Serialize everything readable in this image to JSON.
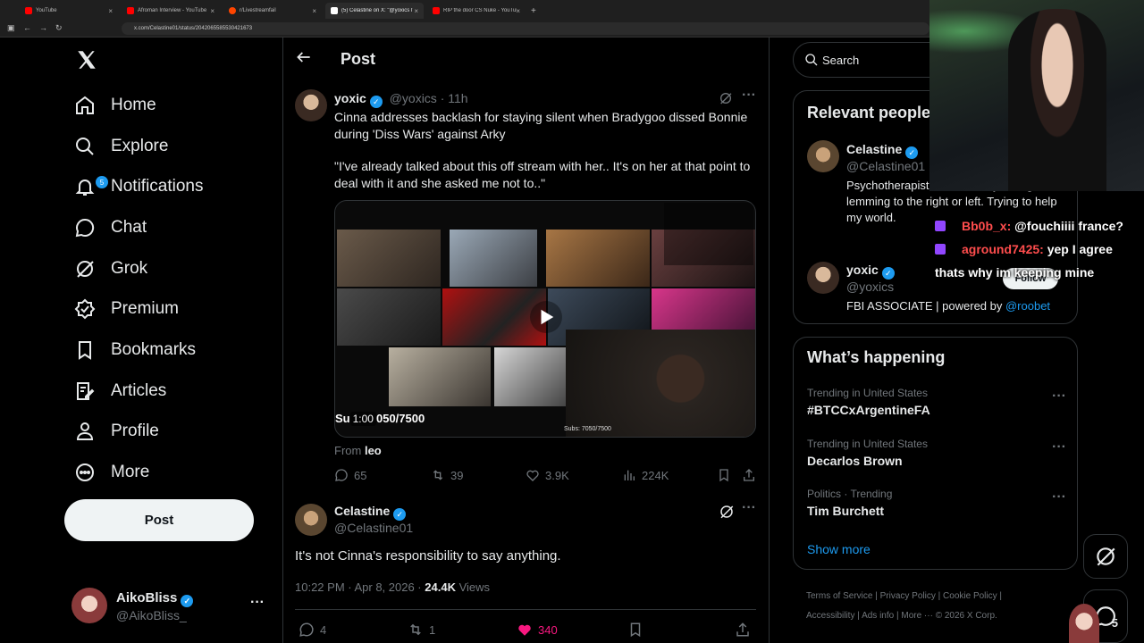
{
  "browser": {
    "tabs": [
      {
        "label": "YouTube",
        "color": "#ff0000"
      },
      {
        "label": "Afroman Interview - YouTube",
        "color": "#ff0000"
      },
      {
        "label": "r/Livestreamfail",
        "color": "#ff4500"
      },
      {
        "label": "(5) Celastine on X: \"@yoxics It's",
        "color": "#ffffff"
      },
      {
        "label": "RIP the door CS Nuke - YouTub",
        "color": "#ff0000"
      }
    ],
    "new_tab": "+",
    "url": "x.com/Celastine01/status/2042065585530421673"
  },
  "nav": {
    "items": [
      {
        "label": "Home",
        "icon": "home-icon"
      },
      {
        "label": "Explore",
        "icon": "search-icon"
      },
      {
        "label": "Notifications",
        "icon": "bell-icon",
        "badge": "5"
      },
      {
        "label": "Chat",
        "icon": "chat-icon"
      },
      {
        "label": "Grok",
        "icon": "grok-icon"
      },
      {
        "label": "Premium",
        "icon": "premium-icon"
      },
      {
        "label": "Bookmarks",
        "icon": "bookmark-icon"
      },
      {
        "label": "Articles",
        "icon": "articles-icon"
      },
      {
        "label": "Profile",
        "icon": "profile-icon"
      },
      {
        "label": "More",
        "icon": "more-circle-icon"
      }
    ],
    "post_button": "Post",
    "account": {
      "name": "AikoBliss",
      "handle": "@AikoBliss_"
    }
  },
  "header": {
    "title": "Post"
  },
  "quoted_post": {
    "name": "yoxic",
    "handle": "@yoxics",
    "time": "· 11h",
    "text1": "Cinna addresses backlash for staying silent when Bradygoo dissed Bonnie during 'Diss Wars' against Arky",
    "text2": "\"I've already talked about this off stream with her.. It's on her at that point to deal with it and she asked me not to..\"",
    "video_time": "1:00",
    "overlay_text": "Su",
    "overlay_subs": "050/7500",
    "overlay_subs_small": "Subs: 7050/7500",
    "source_label": "From",
    "source_name": "leo",
    "stats": {
      "replies": "65",
      "reposts": "39",
      "likes": "3.9K",
      "views": "224K"
    }
  },
  "main_post": {
    "name": "Celastine",
    "handle": "@Celastine01",
    "text": "It's not Cinna's responsibility to say anything.",
    "timestamp": "10:22 PM · Apr 8, 2026 ·",
    "views_count": "24.4K",
    "views_label": "Views",
    "stats": {
      "replies": "4",
      "reposts": "1",
      "likes": "340"
    },
    "like_color": "#f91880"
  },
  "search": {
    "placeholder": "Search"
  },
  "relevant": {
    "title": "Relevant people",
    "people": [
      {
        "name": "Celastine",
        "handle": "@Celastine01",
        "bio": "Psychotherapist. Neutral. Psychological lemming to the right or left. Trying to help my world."
      },
      {
        "name": "yoxic",
        "handle": "@yoxics",
        "bio": "FBI ASSOCIATE | powered by ",
        "bio_link": "@roobet",
        "follow": "Follow"
      }
    ]
  },
  "happening": {
    "title": "What’s happening",
    "trends": [
      {
        "context": "Trending in United States",
        "name": "#BTCCxArgentineFA"
      },
      {
        "context": "Trending in United States",
        "name": "Decarlos Brown"
      },
      {
        "context": "Politics · Trending",
        "name": "Tim Burchett"
      }
    ],
    "show_more": "Show more"
  },
  "footer": {
    "links": [
      "Terms of Service",
      "Privacy Policy",
      "Cookie Policy",
      "Accessibility",
      "Ads info",
      "More ···"
    ],
    "copyright": "© 2026 X Corp."
  },
  "stream_chat": [
    {
      "user": "Bb0b_x:",
      "message": "@fouchiiii france?",
      "color": "#ff4d4d"
    },
    {
      "user": "aground7425:",
      "message": "yep I agree",
      "color": "#ff4d4d"
    },
    {
      "user": "",
      "message": "thats why im keeping mine",
      "color": "#ffffff"
    }
  ],
  "floating": {
    "messages_badge": "5"
  }
}
